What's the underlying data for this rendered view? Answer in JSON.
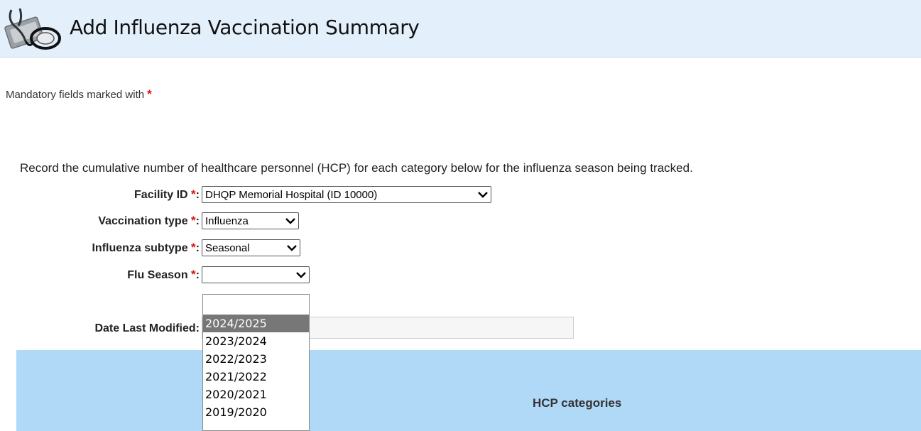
{
  "header": {
    "title": "Add Influenza Vaccination Summary",
    "icon": "stethoscope-icon"
  },
  "mandatory": {
    "text": "Mandatory fields marked with",
    "marker": "*"
  },
  "instructions": "Record the cumulative number of healthcare personnel (HCP) for each category below for the influenza season being tracked.",
  "form": {
    "facility": {
      "label": "Facility ID",
      "value": "DHQP Memorial Hospital (ID 10000)"
    },
    "vaccination_type": {
      "label": "Vaccination type",
      "value": "Influenza"
    },
    "influenza_subtype": {
      "label": "Influenza subtype",
      "value": "Seasonal"
    },
    "flu_season": {
      "label": "Flu Season",
      "value": "",
      "options": [
        "",
        "2024/2025",
        "2023/2024",
        "2022/2023",
        "2021/2022",
        "2020/2021",
        "2019/2020"
      ],
      "highlighted": "2024/2025"
    },
    "date_last_modified": {
      "label": "Date Last Modified:",
      "value": ""
    }
  },
  "table": {
    "header": "HCP categories"
  },
  "colors": {
    "header_bg": "#e3effb",
    "table_header_bg": "#b0d8f7",
    "required_star": "#e01010",
    "dropdown_highlight": "#777777"
  }
}
